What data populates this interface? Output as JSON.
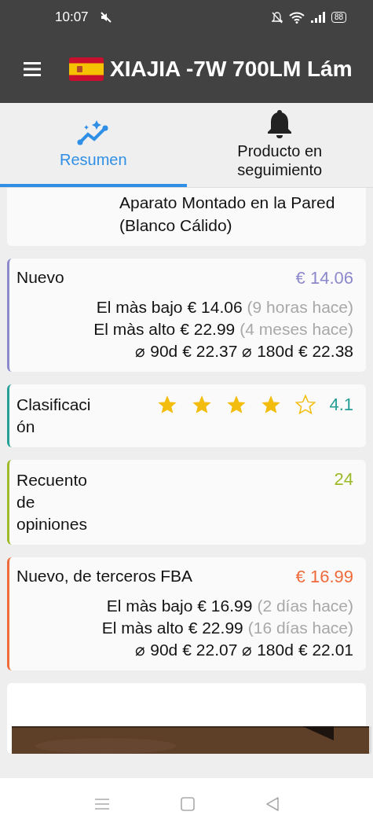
{
  "status_bar": {
    "time": "10:07",
    "battery": "88"
  },
  "app_bar": {
    "title": "XIAJIA -7W 700LM Lám"
  },
  "tabs": [
    {
      "label": "Resumen",
      "selected": true
    },
    {
      "label": "Producto en seguimiento",
      "selected": false
    }
  ],
  "cards": [
    {
      "kind": "text",
      "text": "Aparato Montado en la Pared (Blanco Cálido)"
    },
    {
      "kind": "price",
      "title": "Nuevo",
      "value": "€ 14.06",
      "color": "#8c88cc",
      "rows": [
        {
          "label": "El màs bajo",
          "price": "€ 14.06",
          "ago": "(9 horas hace)"
        },
        {
          "label": "El màs alto",
          "price": "€ 22.99",
          "ago": "(4 meses hace)"
        }
      ],
      "averages": [
        {
          "label": "⌀ 90d",
          "price": "€ 22.37"
        },
        {
          "label": "⌀ 180d",
          "price": "€ 22.38"
        }
      ]
    },
    {
      "kind": "rating",
      "title": "Clasificación",
      "value": "4.1",
      "stars": 4,
      "color": "#26a096"
    },
    {
      "kind": "count",
      "title": "Recuento de opiniones",
      "value": "24",
      "color": "#9cba2a"
    },
    {
      "kind": "price",
      "title": "Nuevo, de terceros FBA",
      "value": "€ 16.99",
      "color": "#ef6a3a",
      "rows": [
        {
          "label": "El màs bajo",
          "price": "€ 16.99",
          "ago": "(2 días hace)"
        },
        {
          "label": "El màs alto",
          "price": "€ 22.99",
          "ago": "(16 días hace)"
        }
      ],
      "averages": [
        {
          "label": "⌀ 90d",
          "price": "€ 22.07"
        },
        {
          "label": "⌀ 180d",
          "price": "€ 22.01"
        }
      ]
    },
    {
      "kind": "picture"
    }
  ]
}
